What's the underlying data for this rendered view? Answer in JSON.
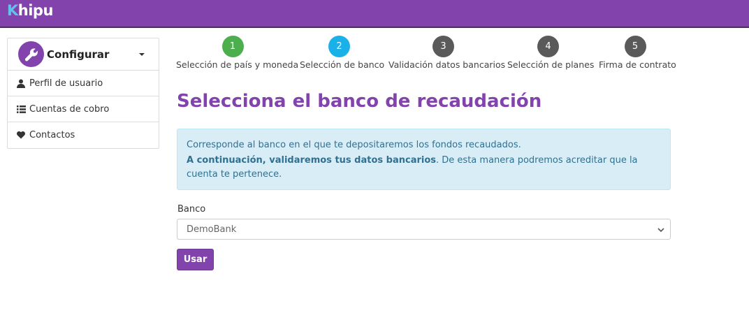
{
  "header": {
    "logo_k": "K",
    "logo_rest": "hipu",
    "bg_color": "#8244ac"
  },
  "sidebar": {
    "title": "Configurar",
    "icon": "wrench-icon",
    "items": [
      {
        "label": "Perfil de usuario",
        "icon": "user-icon"
      },
      {
        "label": "Cuentas de cobro",
        "icon": "list-icon"
      },
      {
        "label": "Contactos",
        "icon": "heart-icon"
      }
    ]
  },
  "steps": [
    {
      "num": "1",
      "label": "Selección de país y moneda",
      "color": "#4cae4c"
    },
    {
      "num": "2",
      "label": "Selección de banco",
      "color": "#1ab0e8"
    },
    {
      "num": "3",
      "label": "Validación datos bancarios",
      "color": "#5a5a5a"
    },
    {
      "num": "4",
      "label": "Selección de planes",
      "color": "#5a5a5a"
    },
    {
      "num": "5",
      "label": "Firma de contrato",
      "color": "#5a5a5a"
    }
  ],
  "main": {
    "title": "Selecciona el banco de recaudación",
    "alert": {
      "line1": "Corresponde al banco en el que te depositaremos los fondos recaudados.",
      "line2_bold": "A continuación, validaremos tus datos bancarios",
      "line2_rest": ". De esta manera podremos acreditar que la cuenta te pertenece."
    },
    "bank_label": "Banco",
    "bank_selected": "DemoBank",
    "submit_label": "Usar"
  }
}
